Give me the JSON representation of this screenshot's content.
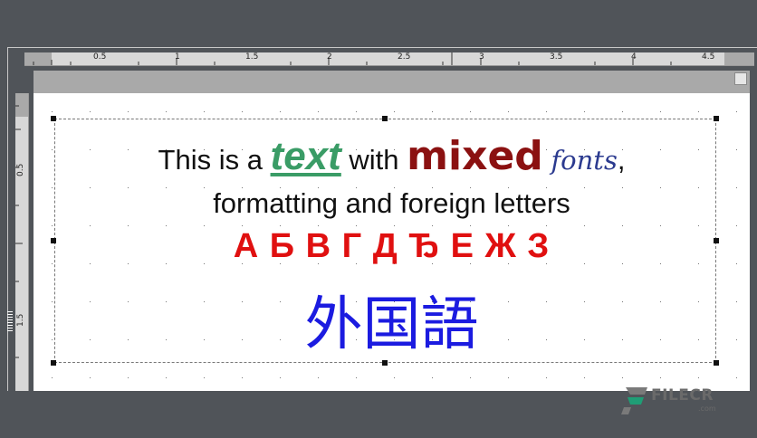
{
  "ruler": {
    "h_labels": [
      "0.5",
      "1",
      "1.5",
      "2",
      "2.5",
      "3",
      "3.5",
      "4",
      "4.5"
    ],
    "v_labels": [
      "0.5",
      "1.5"
    ]
  },
  "content": {
    "line1": {
      "p1": "This is a ",
      "w_text": "text",
      "p2": " with ",
      "w_mixed": "mixed",
      "p3": " ",
      "w_fonts": "fonts",
      "p4": ","
    },
    "line2": "formatting and foreign letters",
    "line3": "А Б В Г Д Ђ Е Ж З",
    "line4": "外国語"
  },
  "watermark": {
    "text": "FILECR",
    "sub": ".com"
  },
  "colors": {
    "text_green": "#3a9c66",
    "mixed_red": "#8b1111",
    "fonts_blue": "#2b3a8f",
    "cyrillic_red": "#e01010",
    "cjk_blue": "#1b1be0"
  }
}
